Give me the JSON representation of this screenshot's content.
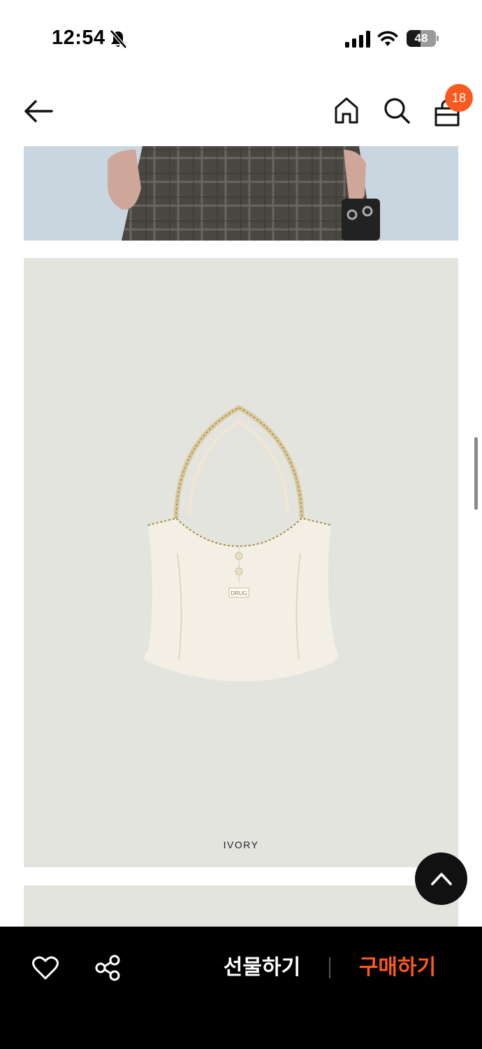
{
  "status_bar": {
    "time": "12:54",
    "battery_level": "48",
    "icons": [
      "bell-slash-icon",
      "cellular-signal-icon",
      "wifi-icon",
      "battery-icon"
    ]
  },
  "header": {
    "icons": [
      "back-arrow-icon",
      "home-icon",
      "search-icon",
      "shopping-bag-icon"
    ],
    "cart_count": "18"
  },
  "product": {
    "color_label": "IVORY",
    "tag_text": "DRUG"
  },
  "bottom_bar": {
    "gift_label": "선물하기",
    "buy_label": "구매하기",
    "icons": [
      "heart-icon",
      "share-icon"
    ]
  },
  "colors": {
    "accent": "#fa5a1e",
    "bottom_bar_bg": "#000000",
    "card_bg": "#e4e4de",
    "sky": "#c9d6df"
  }
}
